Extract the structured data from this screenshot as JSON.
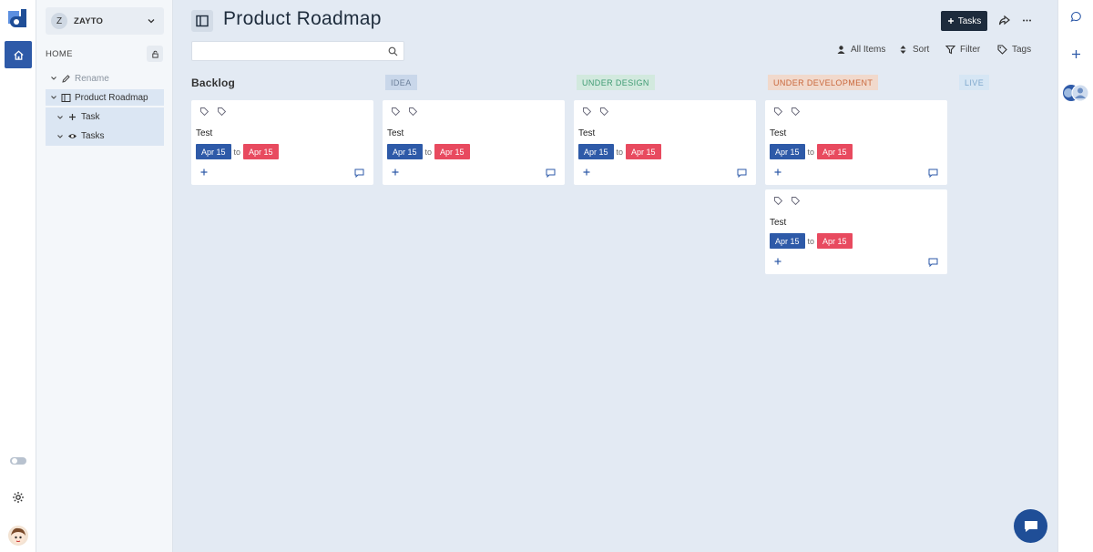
{
  "workspace": {
    "badge": "Z",
    "name": "ZAYTO"
  },
  "nav": {
    "home_label": "HOME"
  },
  "tree": {
    "rename": "Rename",
    "project": "Product Roadmap",
    "task": "Task",
    "tasks": "Tasks"
  },
  "header": {
    "title": "Product Roadmap",
    "tasks_button": "Tasks"
  },
  "search": {
    "placeholder": ""
  },
  "toolbar": {
    "all_items": "All Items",
    "sort": "Sort",
    "filter": "Filter",
    "tags": "Tags"
  },
  "columns": [
    {
      "label": "Backlog",
      "bg": "",
      "color": "#333333"
    },
    {
      "label": "IDEA",
      "bg": "#c9d7ea",
      "color": "#6b7f99"
    },
    {
      "label": "UNDER DESIGN",
      "bg": "#d2e9de",
      "color": "#3f9b73"
    },
    {
      "label": "UNDER DEVELOPMENT",
      "bg": "#f1d9cc",
      "color": "#c9673b"
    },
    {
      "label": "LIVE",
      "bg": "#d6e6f4",
      "color": "#7fa8cd"
    }
  ],
  "cards": [
    {
      "title": "Test",
      "start": "Apr 15",
      "to": "to",
      "end": "Apr 15"
    },
    {
      "title": "Test",
      "start": "Apr 15",
      "to": "to",
      "end": "Apr 15"
    },
    {
      "title": "Test",
      "start": "Apr 15",
      "to": "to",
      "end": "Apr 15"
    },
    {
      "title": "Test",
      "start": "Apr 15",
      "to": "to",
      "end": "Apr 15"
    },
    {
      "title": "Test",
      "start": "Apr 15",
      "to": "to",
      "end": "Apr 15"
    }
  ],
  "colors": {
    "accent": "#2e5aa8",
    "date_end": "#e84a5f",
    "dark_button": "#1d2b3c"
  }
}
